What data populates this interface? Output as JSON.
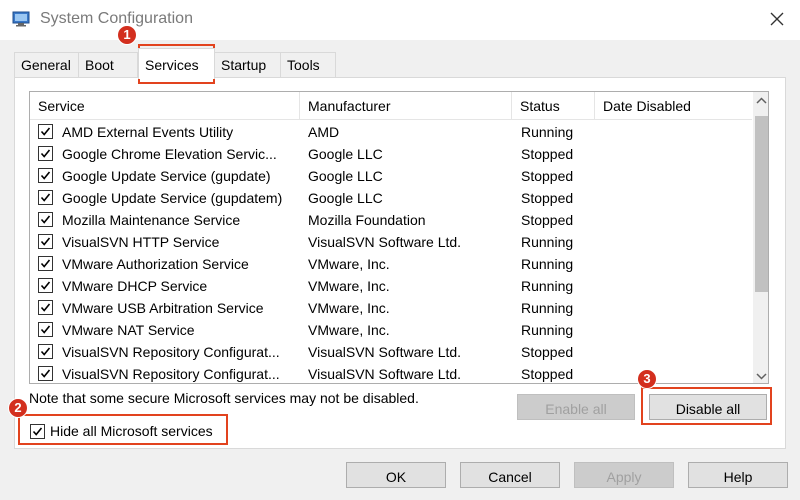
{
  "window": {
    "title": "System Configuration"
  },
  "tabs": [
    {
      "label": "General"
    },
    {
      "label": "Boot"
    },
    {
      "label": "Services"
    },
    {
      "label": "Startup"
    },
    {
      "label": "Tools"
    }
  ],
  "active_tab": "Services",
  "columns": [
    "Service",
    "Manufacturer",
    "Status",
    "Date Disabled"
  ],
  "services": [
    {
      "name": "AMD External Events Utility",
      "manufacturer": "AMD",
      "status": "Running",
      "date_disabled": "",
      "checked": true
    },
    {
      "name": "Google Chrome Elevation Servic...",
      "manufacturer": "Google LLC",
      "status": "Stopped",
      "date_disabled": "",
      "checked": true
    },
    {
      "name": "Google Update Service (gupdate)",
      "manufacturer": "Google LLC",
      "status": "Stopped",
      "date_disabled": "",
      "checked": true
    },
    {
      "name": "Google Update Service (gupdatem)",
      "manufacturer": "Google LLC",
      "status": "Stopped",
      "date_disabled": "",
      "checked": true
    },
    {
      "name": "Mozilla Maintenance Service",
      "manufacturer": "Mozilla Foundation",
      "status": "Stopped",
      "date_disabled": "",
      "checked": true
    },
    {
      "name": "VisualSVN HTTP Service",
      "manufacturer": "VisualSVN Software Ltd.",
      "status": "Running",
      "date_disabled": "",
      "checked": true
    },
    {
      "name": "VMware Authorization Service",
      "manufacturer": "VMware, Inc.",
      "status": "Running",
      "date_disabled": "",
      "checked": true
    },
    {
      "name": "VMware DHCP Service",
      "manufacturer": "VMware, Inc.",
      "status": "Running",
      "date_disabled": "",
      "checked": true
    },
    {
      "name": "VMware USB Arbitration Service",
      "manufacturer": "VMware, Inc.",
      "status": "Running",
      "date_disabled": "",
      "checked": true
    },
    {
      "name": "VMware NAT Service",
      "manufacturer": "VMware, Inc.",
      "status": "Running",
      "date_disabled": "",
      "checked": true
    },
    {
      "name": "VisualSVN Repository Configurat...",
      "manufacturer": "VisualSVN Software Ltd.",
      "status": "Stopped",
      "date_disabled": "",
      "checked": true
    },
    {
      "name": "VisualSVN Repository Configurat...",
      "manufacturer": "VisualSVN Software Ltd.",
      "status": "Stopped",
      "date_disabled": "",
      "checked": true
    }
  ],
  "note": "Note that some secure Microsoft services may not be disabled.",
  "enable_all_label": "Enable all",
  "disable_all_label": "Disable all",
  "hide_ms_label": "Hide all Microsoft services",
  "hide_ms_checked": true,
  "footer": {
    "ok": "OK",
    "cancel": "Cancel",
    "apply": "Apply",
    "help": "Help"
  },
  "annotations": [
    "1",
    "2",
    "3"
  ],
  "colors": {
    "highlight": "#e2431e",
    "badge": "#d32f1e",
    "window_bg": "#f0f0f0"
  }
}
